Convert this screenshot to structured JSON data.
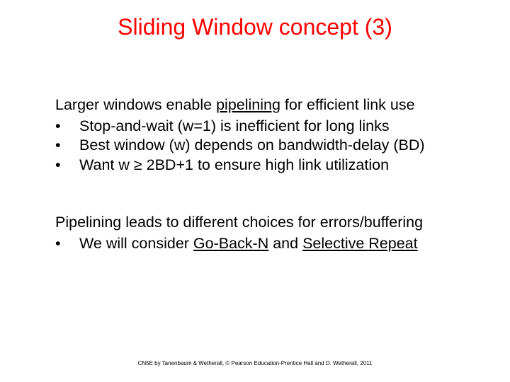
{
  "title": "Sliding Window concept (3)",
  "section1": {
    "lead_pre": "Larger windows enable ",
    "lead_underlined": "pipelining",
    "lead_post": " for efficient link use",
    "bullets": [
      "Stop-and-wait (w=1) is inefficient for long links",
      "Best window (w) depends on bandwidth-delay (BD)",
      "Want w ≥ 2BD+1 to ensure high link utilization"
    ]
  },
  "section2": {
    "lead": "Pipelining leads to different  choices for errors/buffering",
    "bullet_pre": "We will consider ",
    "bullet_u1": "Go-Back-N",
    "bullet_mid": " and ",
    "bullet_u2": "Selective Repeat"
  },
  "bullet_char": "•",
  "footer": "CN5E by Tanenbaum & Wetherall, © Pearson Education-Prentice Hall and D. Wetherall, 2011"
}
